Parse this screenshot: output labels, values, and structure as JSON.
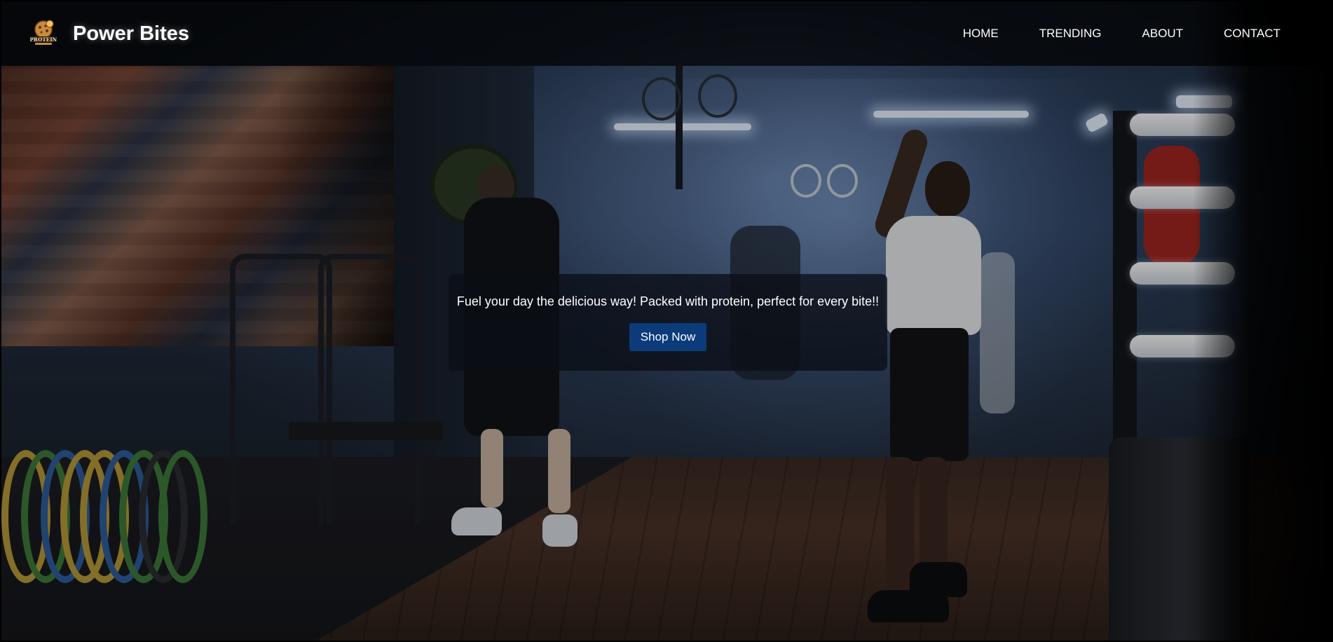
{
  "brand": {
    "name": "Power Bites",
    "logo_text": "PROTEIN"
  },
  "nav": {
    "items": [
      {
        "label": "HOME"
      },
      {
        "label": "TRENDING"
      },
      {
        "label": "ABOUT"
      },
      {
        "label": "CONTACT"
      }
    ]
  },
  "hero": {
    "tagline": "Fuel your day the delicious way! Packed with protein, perfect for every bite!!",
    "cta_label": "Shop Now",
    "background_image": "gym-scene-photo"
  },
  "colors": {
    "navbar_bg": "#000000",
    "cta_button": "#0b3b7a",
    "text": "#ffffff",
    "logo_accent": "#c98a3a"
  }
}
